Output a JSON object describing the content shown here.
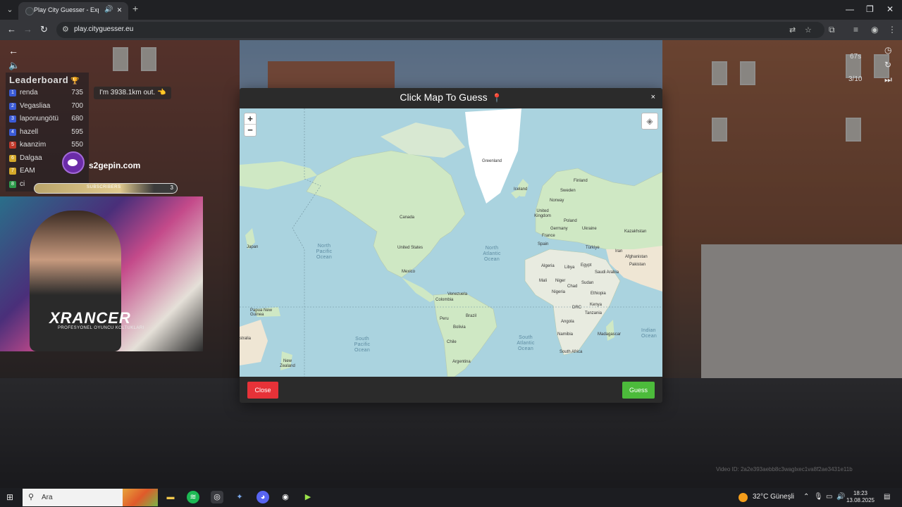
{
  "browser": {
    "tab_title": "Play City Guesser - Explore",
    "url": "play.cityguesser.eu"
  },
  "hud": {
    "leaderboard_title": "Leaderboard",
    "leaderboard": [
      {
        "rank": "1",
        "name": "renda",
        "score": "735",
        "color": "#3b5bd6"
      },
      {
        "rank": "2",
        "name": "Vegasliaa",
        "score": "700",
        "color": "#3b5bd6"
      },
      {
        "rank": "3",
        "name": "laponungötü",
        "score": "680",
        "color": "#3b5bd6"
      },
      {
        "rank": "4",
        "name": "hazell",
        "score": "595",
        "color": "#3b5bd6"
      },
      {
        "rank": "5",
        "name": "kaanzim",
        "score": "550",
        "color": "#c0392b"
      },
      {
        "rank": "6",
        "name": "Dalgaa",
        "score": "",
        "color": "#d4a82a"
      },
      {
        "rank": "7",
        "name": "EAM",
        "score": "",
        "color": "#d4a82a"
      },
      {
        "rank": "8",
        "name": "ci",
        "score": "",
        "color": "#2e9b4b"
      }
    ],
    "hint": "I'm 3938.1km out.",
    "timer": "67s",
    "round": "3/10"
  },
  "stream": {
    "promo": "s2gepin.com",
    "subscribers_label": "SUBSCRIBERS",
    "subscribers_count": "3",
    "sponsor_name": "XRANCER",
    "sponsor_tag": "PROFESYONEL OYUNCU KOLTUKLARI",
    "watermark": "Video ID: 2a2e393aebb8c3waglxec1va8f2ae3431e11b"
  },
  "modal": {
    "title": "Click Map To Guess",
    "close_x": "×",
    "zoom_in": "+",
    "zoom_out": "−",
    "close_button": "Close",
    "guess_button": "Guess",
    "colors": {
      "close": "#e63238",
      "guess": "#4cbb3b",
      "ocean": "#aad3df",
      "land": "#cfe8c4"
    }
  },
  "map_labels": {
    "greenland": "Greenland",
    "iceland": "Iceland",
    "sweden": "Sweden",
    "finland": "Finland",
    "norway": "Norway",
    "uk": "United Kingdom",
    "poland": "Poland",
    "germany": "Germany",
    "ukraine": "Ukraine",
    "kazakhstan": "Kazakhstan",
    "france": "France",
    "spain": "Spain",
    "turkiye": "Türkiye",
    "iran": "Iran",
    "afghanistan": "Afghanistan",
    "pakistan": "Pakistan",
    "algeria": "Algeria",
    "libya": "Libya",
    "egypt": "Egypt",
    "saudi": "Saudi Arabia",
    "mali": "Mali",
    "niger": "Niger",
    "chad": "Chad",
    "sudan": "Sudan",
    "nigeria": "Nigeria",
    "ethiopia": "Ethiopia",
    "drc": "DRC",
    "kenya": "Kenya",
    "tanzania": "Tanzania",
    "angola": "Angola",
    "namibia": "Namibia",
    "madagascar": "Madagascar",
    "south_africa": "South Africa",
    "canada": "Canada",
    "us": "United States",
    "mexico": "Mexico",
    "venezuela": "Venezuela",
    "colombia": "Colombia",
    "peru": "Peru",
    "brazil": "Brazil",
    "bolivia": "Bolivia",
    "chile": "Chile",
    "argentina": "Argentina",
    "japan": "Japan",
    "png": "Papua New Guinea",
    "australia": "stralia",
    "nz": "New Zealand",
    "north_pacific": "North Pacific Ocean",
    "north_atlantic": "North Atlantic Ocean",
    "south_pacific": "South Pacific Ocean",
    "south_atlantic": "South Atlantic Ocean",
    "indian": "Indian Ocean"
  },
  "taskbar": {
    "search_placeholder": "Ara",
    "weather": "32°C Güneşli",
    "time": "18:23",
    "date": "13.08.2025"
  }
}
